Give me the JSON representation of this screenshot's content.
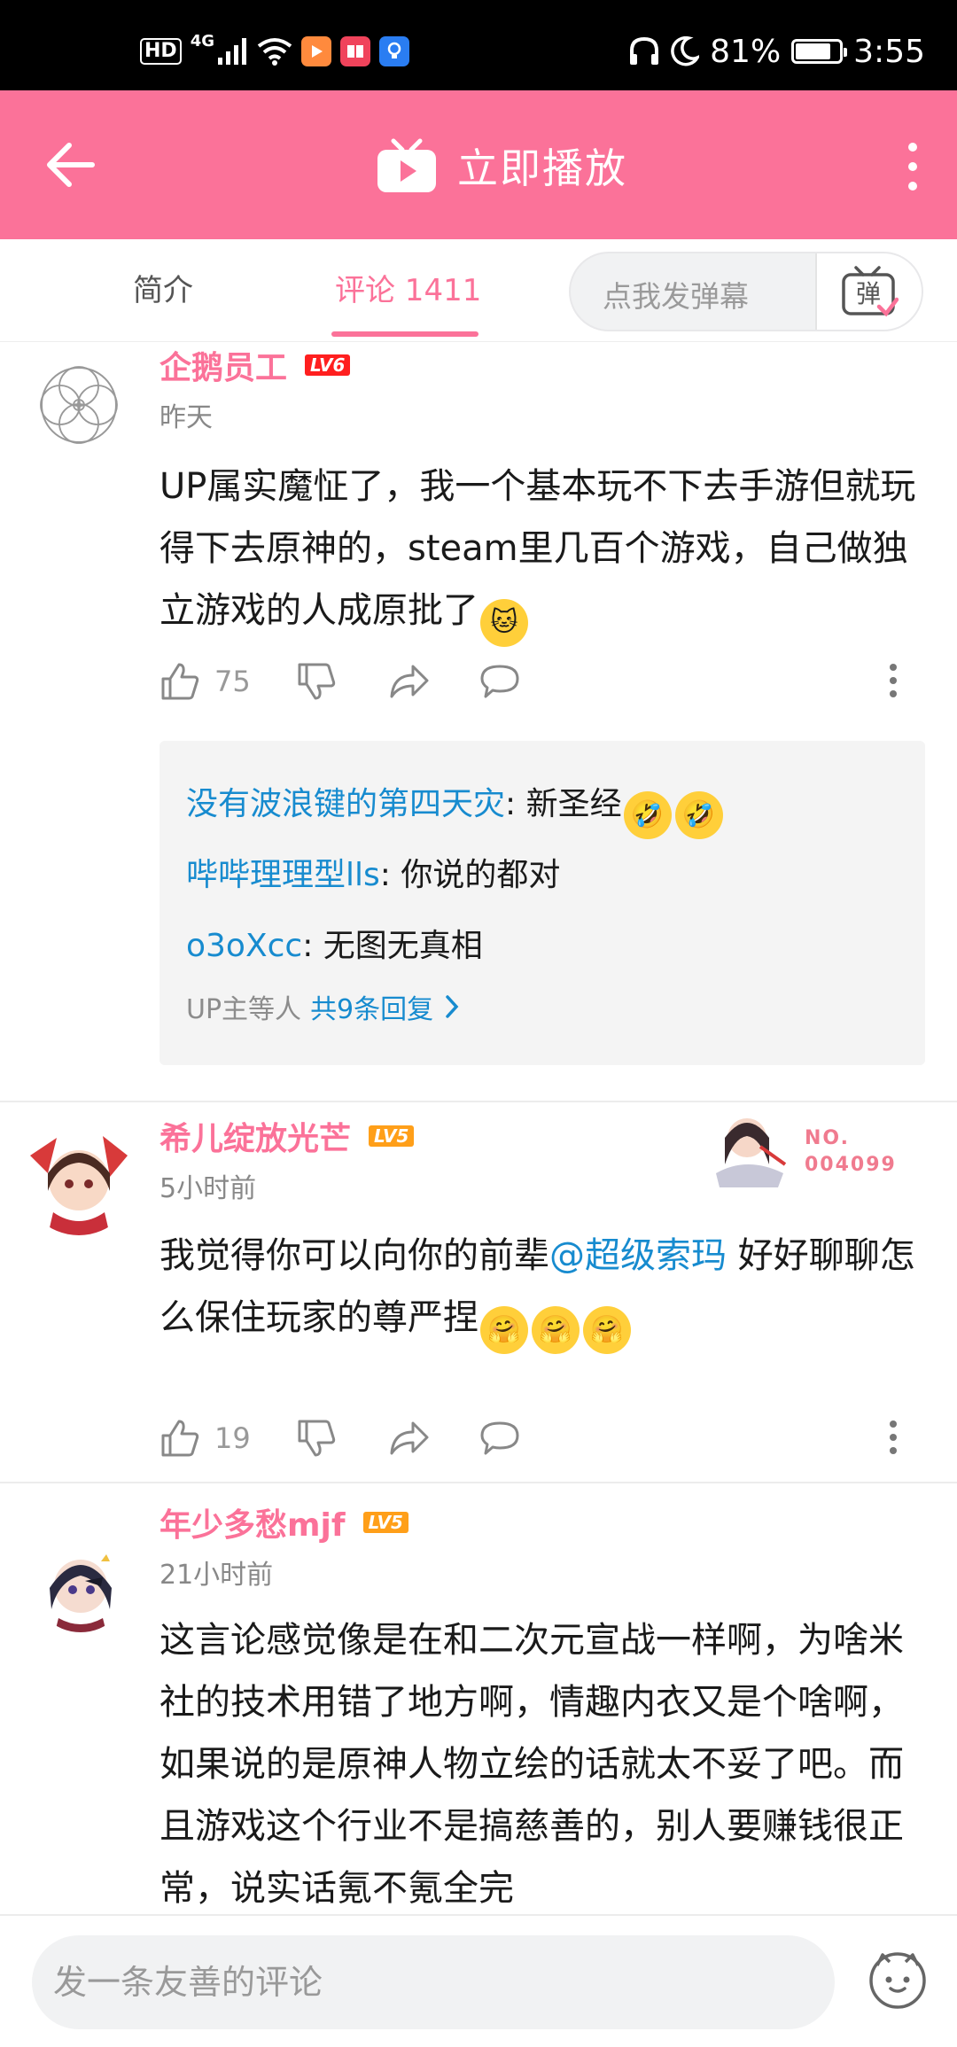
{
  "status_bar": {
    "hd": "HD",
    "network": "4G",
    "battery_percent": "81%",
    "battery_level": 0.81,
    "time": "3:55"
  },
  "app_bar": {
    "play_label": "立即播放"
  },
  "tabs": {
    "intro": "简介",
    "comments": "评论 1411",
    "danmaku_placeholder": "点我发弹幕",
    "danmaku_btn": "弹"
  },
  "comments": [
    {
      "username": "企鹅员工",
      "level": "LV6",
      "time": "昨天",
      "text": "UP属实魔怔了，我一个基本玩不下去手游但就玩得下去原神的，steam里几百个游戏，自己做独立游戏的人成原批了",
      "likes": "75",
      "replies": [
        {
          "name": "没有波浪键的第四天灾",
          "text": ": 新圣经"
        },
        {
          "name": "哔哔理理型lls",
          "text": ": 你说的都对"
        },
        {
          "name": "o3oXcc",
          "text": ": 无图无真相"
        }
      ],
      "reply_prefix": "UP主等人",
      "reply_count": "共9条回复"
    },
    {
      "username": "希儿绽放光芒",
      "level": "LV5",
      "time": "5小时前",
      "badge_no": "NO.",
      "badge_id": "004099",
      "text_before": "我觉得你可以向你的前辈",
      "mention": "@超级索玛",
      "text_after": " 好好聊聊怎么保住玩家的尊严捏",
      "likes": "19"
    },
    {
      "username": "年少多愁mjf",
      "level": "LV5",
      "time": "21小时前",
      "text": "这言论感觉像是在和二次元宣战一样啊，为啥米社的技术用错了地方啊，情趣内衣又是个啥啊，如果说的是原神人物立绘的话就太不妥了吧。而且游戏这个行业不是搞慈善的，别人要赚钱很正常，说实话氪不氪全完"
    }
  ],
  "bottom_bar": {
    "input_placeholder": "发一条友善的评论"
  },
  "colors": {
    "brand_pink": "#fb7299",
    "link_blue": "#178bcf",
    "level6": "#ff1f1f",
    "level5": "#ff9f19"
  }
}
